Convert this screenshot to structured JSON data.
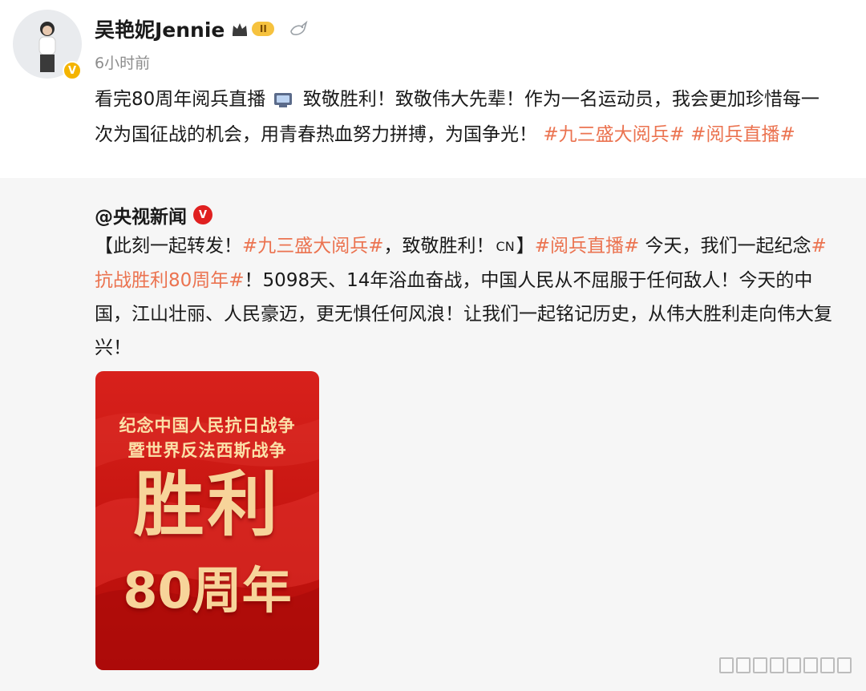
{
  "user": {
    "name": "吴艳妮Jennie",
    "vip_level": "II",
    "timestamp": "6小时前"
  },
  "post": {
    "text_part1": "看完80周年阅兵直播",
    "text_part2": " 致敬胜利！致敬伟大先辈！作为一名运动员，我会更加珍惜每一次为国征战的机会，用青春热血努力拼搏，为国争光！",
    "tag1": "#九三盛大阅兵#",
    "tag2": " #阅兵直播#"
  },
  "repost": {
    "author": "@央视新闻",
    "seg1": "【此刻一起转发！",
    "tag1": "#九三盛大阅兵#",
    "seg2": "，致敬胜利！",
    "cn": "CN",
    "seg3": "】",
    "tag2": "#阅兵直播#",
    "seg4": " 今天，我们一起纪念",
    "tag3": "#抗战胜利80周年#",
    "seg5": "！5098天、14年浴血奋战，中国人民从不屈服于任何敌人！今天的中国，江山壮丽、人民豪迈，更无惧任何风浪！让我们一起铭记历史，从伟大胜利走向伟大复兴！"
  },
  "poster": {
    "line1": "纪念中国人民抗日战争",
    "line2": "暨世界反法西斯战争",
    "line3": "胜利",
    "line4": "80周年"
  },
  "colors": {
    "tag": "#eb7350",
    "poster_red": "#c5140f",
    "gold_text": "#f7d49a",
    "repost_bg": "#f6f6f6"
  },
  "icons": [
    "crown-icon",
    "bird-icon",
    "tv-icon",
    "verified-badge-icon"
  ]
}
